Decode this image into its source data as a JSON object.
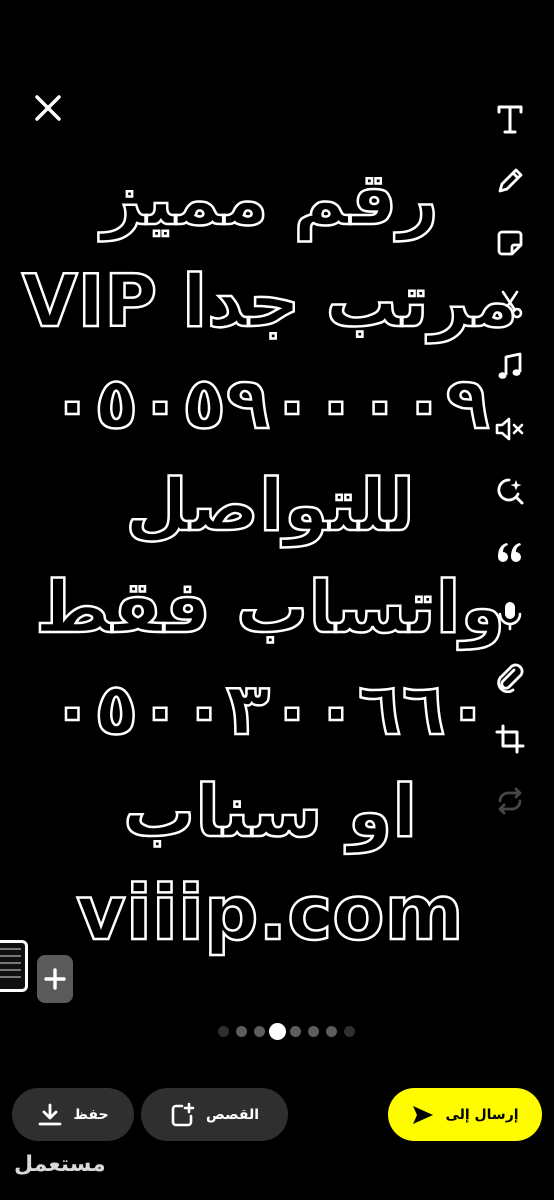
{
  "caption": {
    "lines": [
      "رقم مميز",
      "مرتب جدا VIP",
      "٠٥٠٥٩٠٠٠٠٩",
      "للتواصل",
      "واتساب فقط",
      "٠٥٠٠٣٠٠٦٦٠",
      "او سناب",
      "viiip.com"
    ]
  },
  "toolbar": {
    "icons": [
      "text-icon",
      "pencil-icon",
      "sticker-icon",
      "scissors-icon",
      "music-note-icon",
      "mute-icon",
      "magic-icon",
      "quote-icon",
      "microphone-icon",
      "paperclip-icon",
      "crop-icon",
      "loop-icon"
    ]
  },
  "pagination": {
    "total": 8,
    "active_index": 3
  },
  "actions": {
    "save_label": "حفظ",
    "stories_label": "القصص",
    "send_label": "إرسال إلى"
  },
  "watermark": "مستعمل",
  "colors": {
    "send_accent": "#fffc00"
  }
}
